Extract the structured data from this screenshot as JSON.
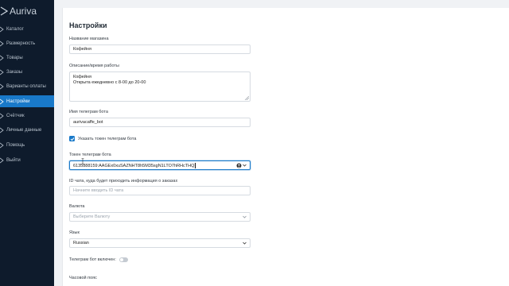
{
  "brand": {
    "name": "Auriva"
  },
  "sidebar": {
    "items": [
      {
        "label": "Каталог",
        "icon": "catalog-icon",
        "active": false
      },
      {
        "label": "Размерность",
        "icon": "sizes-icon",
        "active": false
      },
      {
        "label": "Товары",
        "icon": "products-icon",
        "active": false
      },
      {
        "label": "Заказы",
        "icon": "orders-icon",
        "active": false
      },
      {
        "label": "Варианты оплаты",
        "icon": "payment-icon",
        "active": false
      },
      {
        "label": "Настройки",
        "icon": "settings-icon",
        "active": true
      },
      {
        "label": "Счётчик",
        "icon": "counter-icon",
        "active": false
      },
      {
        "label": "Личные данные",
        "icon": "user-icon",
        "active": false
      },
      {
        "label": "Помощь",
        "icon": "help-icon",
        "active": false
      },
      {
        "label": "Выйти",
        "icon": "logout-icon",
        "active": false
      }
    ]
  },
  "settings": {
    "title": "Настройки",
    "store_name": {
      "label": "Название магазина",
      "value": "Кофейня"
    },
    "description": {
      "label": "Описание/время работы",
      "line1": "Кофейня",
      "line2": "Открыта ежедневно с 8-00 до 20-00"
    },
    "bot_name": {
      "label": "Имя телеграм бота",
      "value": "aurivacaffe_bot"
    },
    "show_token": {
      "label": "Указать токен телеграм бота",
      "checked": true
    },
    "token": {
      "label": "Токен телеграм бота",
      "value": "6135888159:AAGEx0xuSAZNHT8h5M35sgN1LTO7hRHcTHQ"
    },
    "chat_id": {
      "label": "ID чата, куда будет приходить информация о заказах",
      "placeholder": "Начните вводить ID чата"
    },
    "currency": {
      "label": "Валюта",
      "placeholder": "Выберите Валюту"
    },
    "language": {
      "label": "Язык",
      "value": "Russian"
    },
    "bot_enabled": {
      "label": "Телеграм бот включен:",
      "on": false
    },
    "timezone": {
      "label": "Часовой пояс"
    }
  },
  "colors": {
    "sidebar_bg": "#0e1b2c",
    "accent": "#1979c9",
    "page_bg": "#f0f2f5"
  }
}
